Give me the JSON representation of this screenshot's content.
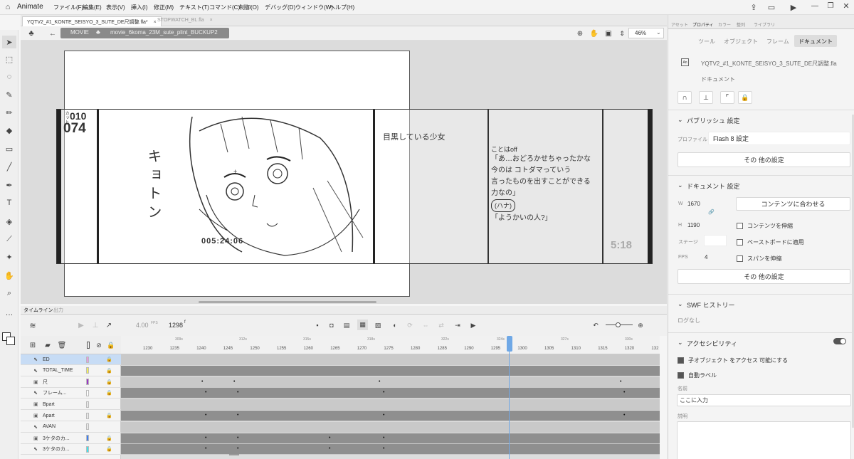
{
  "app": {
    "name": "Animate"
  },
  "menu": [
    "ファイル(F)",
    "編集(E)",
    "表示(V)",
    "挿入(I)",
    "修正(M)",
    "テキスト(T)",
    "コマンド(C)",
    "制御(O)",
    "デバッグ(D)",
    "ウィンドウ(W)",
    "ヘルプ(H)"
  ],
  "doc_tabs": [
    "YQTV2_#1_KONTE_SEISYO_3_SUTE_DE尺調整.fla*",
    "STOPWATCH_BL.fla"
  ],
  "scene": {
    "movie": "MOVIE",
    "symbol": "movie_6koma_23M_sute_plint_BUCKUP2",
    "zoom": "46%"
  },
  "stage_text": {
    "cut_top": "010",
    "cut_label": "カット",
    "cut_main": "074",
    "timecode": "005:24:06",
    "duration": "5:18",
    "note1": "目黒している少女",
    "sfx": "キョトン",
    "dialog": [
      "ことはoff",
      "「あ…おどろかせちゃったかな",
      "今のは コトダマっていう",
      "言ったものを出すことができる",
      "力なの」",
      "(ハナ)",
      "「ようかいの人?」"
    ]
  },
  "timeline": {
    "tabs": [
      "タイムライン",
      "出力"
    ],
    "fps": "4.00",
    "fps_unit": "FPS",
    "frame": "1298",
    "frame_unit": "f",
    "seconds": [
      "309s",
      "312s",
      "315s",
      "318s",
      "322s",
      "324s",
      "327s",
      "330s"
    ],
    "ruler": [
      "1230",
      "1235",
      "1240",
      "1245",
      "1250",
      "1255",
      "1260",
      "1265",
      "1270",
      "1275",
      "1280",
      "1285",
      "1290",
      "1295",
      "1300",
      "1305",
      "1310",
      "1315",
      "1320",
      "132"
    ],
    "layers": [
      {
        "name": "ED",
        "color": "#e59be5",
        "selected": true
      },
      {
        "name": "TOTAL_TIME",
        "color": "#f2ef5b",
        "selected": false
      },
      {
        "name": "尺",
        "color": "#9b35c8",
        "selected": false
      },
      {
        "name": "フレーム...",
        "color": "#ffffff",
        "selected": false
      },
      {
        "name": "Bpart",
        "color": "#e8e8e8",
        "selected": false
      },
      {
        "name": "Apart",
        "color": "#e8e8e8",
        "selected": false
      },
      {
        "name": "AVAN",
        "color": "#e8e8e8",
        "selected": false
      },
      {
        "name": "3ケタのカ...",
        "color": "#3d7ff2",
        "selected": false
      },
      {
        "name": "3ケタのカ...",
        "color": "#3ee8f0",
        "selected": false
      }
    ]
  },
  "right_panel": {
    "top_tabs": [
      "アセット",
      "プロパティ",
      "カラー",
      "整列",
      "ライブラリ"
    ],
    "sub_tabs": [
      "ツール",
      "オブジェクト",
      "フレーム",
      "ドキュメント"
    ],
    "file_name": "YQTV2_#1_KONTE_SEISYO_3_SUTE_DE尺調整.fla",
    "doc_label": "ドキュメント",
    "publish": {
      "title": "パブリッシュ 設定",
      "profile_label": "プロファイル",
      "profile_value": "Flash 8 設定",
      "other_btn": "その 他の設定"
    },
    "document": {
      "title": "ドキュメント 設定",
      "w_label": "W",
      "w_value": "1670",
      "h_label": "H",
      "h_value": "1190",
      "fit_btn": "コンテンツに合わせる",
      "stretch_content": "コンテンツを伸縮",
      "apply_paste": "ペーストボードに適用",
      "stage_label": "ステージ",
      "fps_label": "FPS",
      "fps_value": "4",
      "stretch_span": "スパンを伸縮",
      "other_btn": "その 他の設定"
    },
    "swf": {
      "title": "SWF ヒストリー",
      "value": "ログなし"
    },
    "access": {
      "title": "アクセシビリティ",
      "child": "子オブジェクト をアクセス 可能にする",
      "auto": "自動ラベル",
      "name_label": "名前",
      "name_placeholder": "ここに入力",
      "desc_label": "説明"
    }
  },
  "colors": {
    "accent": "#4a90d9",
    "selected_layer": "#c7dcf5",
    "playhead": "#6fa8e6"
  }
}
